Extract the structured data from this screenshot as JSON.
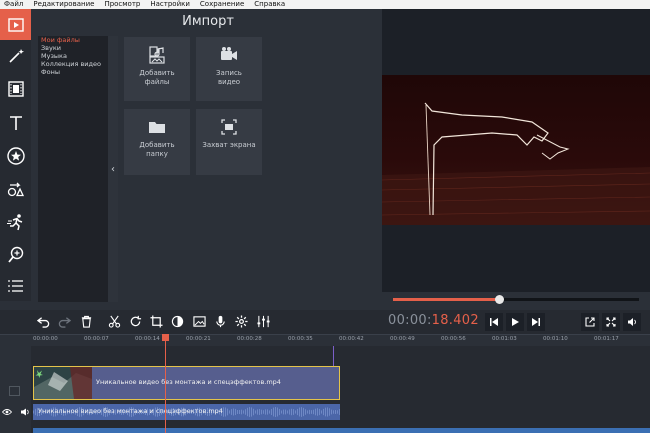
{
  "menu": [
    "Файл",
    "Редактирование",
    "Просмотр",
    "Настройки",
    "Сохранение",
    "Справка"
  ],
  "toolbar": {
    "items": [
      {
        "icon": "import-media-icon",
        "active": true
      },
      {
        "icon": "magic-wand-icon",
        "active": false
      },
      {
        "icon": "film-filters-icon",
        "active": false
      },
      {
        "icon": "titles-icon",
        "active": false
      },
      {
        "icon": "stickers-star-icon",
        "active": false
      },
      {
        "icon": "transitions-icon",
        "active": false
      },
      {
        "icon": "motion-runner-icon",
        "active": false
      },
      {
        "icon": "zoom-icon",
        "active": false
      },
      {
        "icon": "more-list-icon",
        "active": false
      }
    ]
  },
  "import": {
    "title": "Импорт",
    "categories": [
      "Мои файлы",
      "Звуки",
      "Музыка",
      "Коллекция видео",
      "Фоны"
    ],
    "selected": "Мои файлы",
    "tiles": {
      "add_files": "Добавить\nфайлы",
      "record_video": "Запись\nвидео",
      "add_folder": "Добавить\nпапку",
      "screen_capture": "Захват экрана"
    }
  },
  "player": {
    "time_prefix": "00:00:",
    "time_current": "18.402",
    "progress": 0.43
  },
  "timeline": {
    "ticks": [
      "00:00:00",
      "00:00:07",
      "00:00:14",
      "00:00:21",
      "00:00:28",
      "00:00:35",
      "00:00:42",
      "00:00:49",
      "00:00:56",
      "00:01:03",
      "00:01:10",
      "00:01:17"
    ],
    "video_clip_title": "Уникальное видео без монтажа и спецэффектов.mp4",
    "audio_clip_title": "Уникальное видео без монтажа и спецэффектов.mp4"
  },
  "colors": {
    "accent": "#e5604a",
    "clip_border": "#e4c44a",
    "video_clip": "#565e8e",
    "audio_clip": "#4b66a8"
  }
}
